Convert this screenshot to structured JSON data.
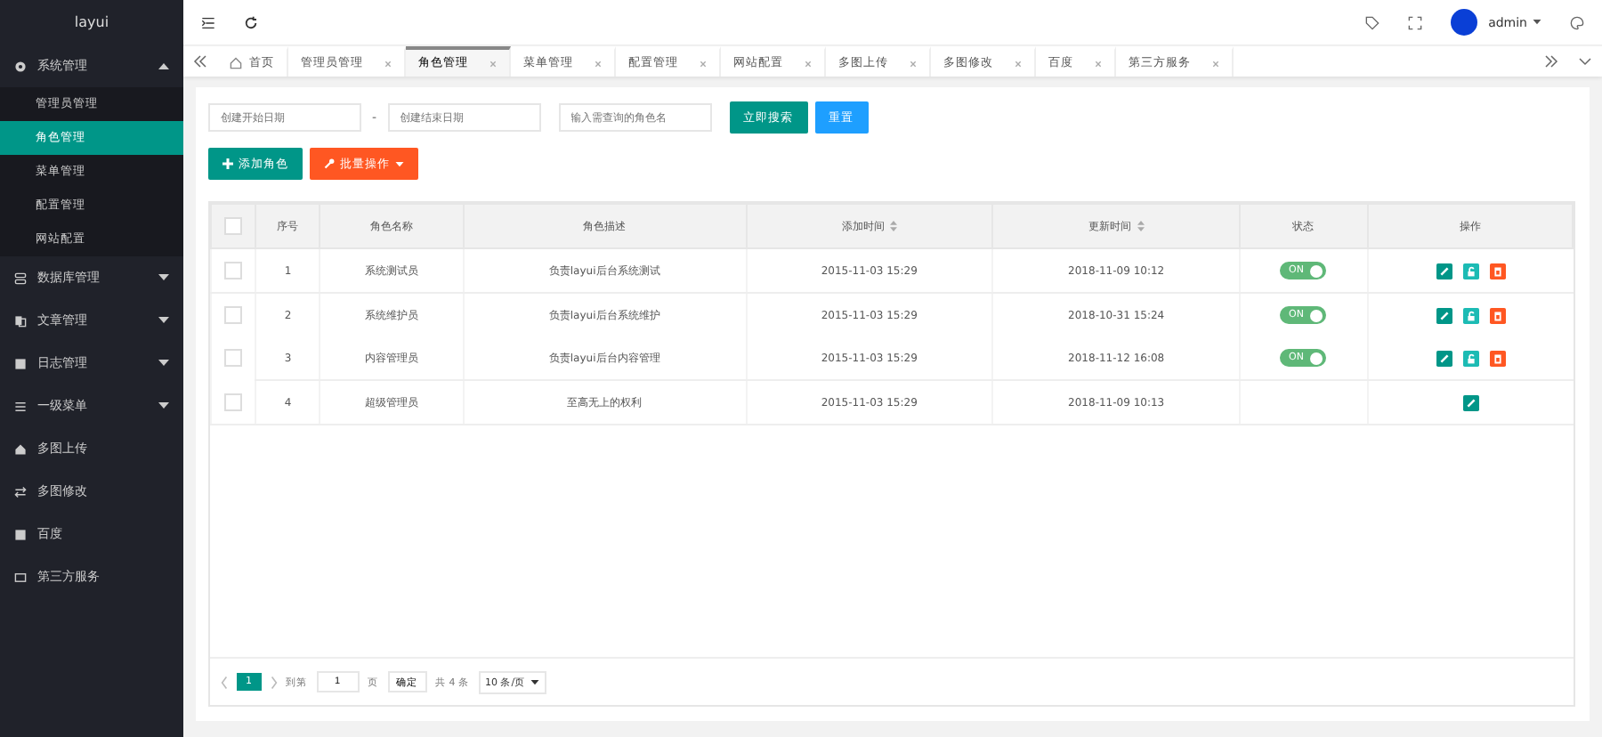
{
  "logo": "layui",
  "header": {
    "username": "admin"
  },
  "sidebar": {
    "items": [
      {
        "label": "系统管理",
        "expanded": true,
        "children": [
          {
            "label": "管理员管理",
            "selected": false
          },
          {
            "label": "角色管理",
            "selected": true
          },
          {
            "label": "菜单管理",
            "selected": false
          },
          {
            "label": "配置管理",
            "selected": false
          },
          {
            "label": "网站配置",
            "selected": false
          }
        ]
      },
      {
        "label": "数据库管理",
        "expanded": false
      },
      {
        "label": "文章管理",
        "expanded": false
      },
      {
        "label": "日志管理",
        "expanded": false
      },
      {
        "label": "一级菜单",
        "expanded": false
      },
      {
        "label": "多图上传"
      },
      {
        "label": "多图修改"
      },
      {
        "label": "百度"
      },
      {
        "label": "第三方服务"
      }
    ]
  },
  "tabs": [
    {
      "label": "首页",
      "selected": false,
      "kind": "home"
    },
    {
      "label": "管理员管理",
      "selected": false,
      "kind": "page"
    },
    {
      "label": "角色管理",
      "selected": true,
      "kind": "page"
    },
    {
      "label": "菜单管理",
      "selected": false,
      "kind": "page"
    },
    {
      "label": "配置管理",
      "selected": false,
      "kind": "page"
    },
    {
      "label": "网站配置",
      "selected": false,
      "kind": "page"
    },
    {
      "label": "多图上传",
      "selected": false,
      "kind": "page"
    },
    {
      "label": "多图修改",
      "selected": false,
      "kind": "page"
    },
    {
      "label": "百度",
      "selected": false,
      "kind": "page"
    },
    {
      "label": "第三方服务",
      "selected": false,
      "kind": "page"
    }
  ],
  "search": {
    "start_placeholder": "创建开始日期",
    "separator": "-",
    "end_placeholder": "创建结束日期",
    "name_placeholder": "输入需查询的角色名",
    "search_button": "立即搜索",
    "reset_button": "重置"
  },
  "toolbar": {
    "add_button": "添加角色",
    "batch_button": "批量操作"
  },
  "table": {
    "select_all_checked": false,
    "columns": [
      "序号",
      "角色名称",
      "角色描述",
      "添加时间",
      "更新时间",
      "状态",
      "操作"
    ],
    "rows": [
      {
        "checked": false,
        "cells": [
          "1",
          "系统测试员",
          "负责layui后台系统测试",
          "2015-11-03 15:29",
          "2018-11-09 10:12"
        ],
        "status": {
          "on": true,
          "label": "ON"
        },
        "actions": [
          {
            "kind": "edit"
          },
          {
            "kind": "unlock"
          },
          {
            "kind": "delete"
          }
        ]
      },
      {
        "checked": false,
        "cells": [
          "2",
          "系统维护员",
          "负责layui后台系统维护",
          "2015-11-03 15:29",
          "2018-10-31 15:24"
        ],
        "status": {
          "on": true,
          "label": "ON"
        },
        "actions": [
          {
            "kind": "edit"
          },
          {
            "kind": "unlock"
          },
          {
            "kind": "delete"
          }
        ]
      },
      {
        "checked": false,
        "cells": [
          "3",
          "内容管理员",
          "负责layui后台内容管理",
          "2015-11-03 15:29",
          "2018-11-12 16:08"
        ],
        "status": {
          "on": true,
          "label": "ON"
        },
        "actions": [
          {
            "kind": "edit"
          },
          {
            "kind": "unlock"
          },
          {
            "kind": "delete"
          }
        ]
      },
      {
        "checked": false,
        "cells": [
          "4",
          "超级管理员",
          "至高无上的权利",
          "2015-11-03 15:29",
          "2018-11-09 10:13"
        ],
        "actions": [
          {
            "kind": "edit"
          }
        ]
      }
    ]
  },
  "pagination": {
    "current": "1",
    "goto_label": "到第",
    "page_value": "1",
    "page_unit": "页",
    "confirm": "确定",
    "total": "共 4 条",
    "page_size": "10 条/页"
  }
}
